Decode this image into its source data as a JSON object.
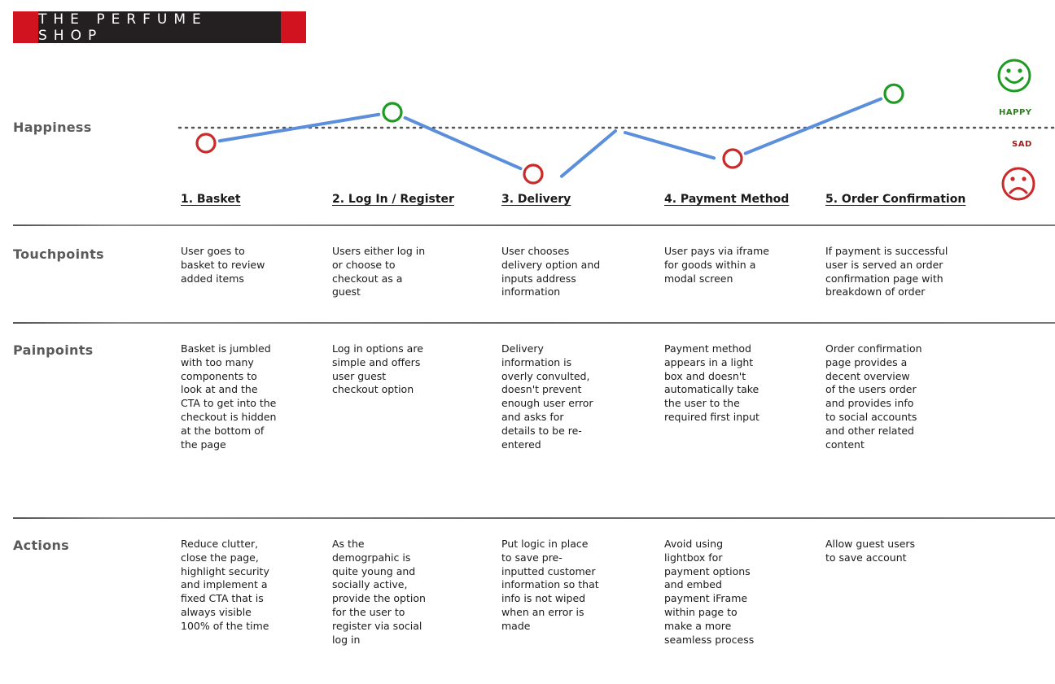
{
  "brand": {
    "name": "THE PERFUME SHOP"
  },
  "legend": {
    "happy_label": "HAPPY",
    "sad_label": "SAD",
    "happy_color": "#1f9a23",
    "sad_color": "#c92a2a"
  },
  "row_labels": {
    "happiness": "Happiness",
    "touchpoints": "Touchpoints",
    "painpoints": "Painpoints",
    "actions": "Actions"
  },
  "chart_data": {
    "type": "line",
    "title": "Happiness",
    "categories": [
      "1. Basket",
      "2. Log In / Register",
      "3. Delivery",
      "4. Payment Method",
      "5. Order Confirmation"
    ],
    "series": [
      {
        "name": "Happiness",
        "values": [
          -1.0,
          1.0,
          -3.0,
          -2.0,
          2.2
        ],
        "color": "#5b8fdb"
      }
    ],
    "point_states": [
      "sad",
      "happy",
      "sad",
      "sad",
      "happy"
    ],
    "baseline": 0,
    "baseline_style": "dotted",
    "ylim": [
      -4,
      4
    ],
    "ylabels": {
      "top": "HAPPY",
      "bottom": "SAD"
    }
  },
  "steps": [
    {
      "title": "1. Basket",
      "touchpoint": "User goes to\nbasket to review\nadded items",
      "painpoint": "Basket is jumbled\nwith too many\ncomponents to\nlook at and the\nCTA to get into the\ncheckout is hidden\nat the bottom of\nthe page",
      "action": "Reduce clutter,\nclose the page,\nhighlight security\nand implement a\nfixed CTA that is\nalways visible\n100% of the time"
    },
    {
      "title": "2. Log In / Register",
      "touchpoint": "Users either log in\nor choose to\ncheckout as a\nguest",
      "painpoint": "Log in options are\nsimple and offers\nuser guest\ncheckout option",
      "action": "As the\ndemogrpahic is\nquite young and\nsocially active,\nprovide the option\nfor the user to\nregister via social\nlog in"
    },
    {
      "title": "3. Delivery",
      "touchpoint": "User chooses\ndelivery option and\ninputs address\ninformation",
      "painpoint": "Delivery\ninformation is\noverly convulted,\ndoesn't prevent\nenough user error\nand asks for\ndetails to be re-\nentered",
      "action": "Put logic in place\nto save pre-\ninputted customer\ninformation so that\ninfo is not wiped\nwhen an error is\nmade"
    },
    {
      "title": "4. Payment Method",
      "touchpoint": "User pays via iframe\nfor goods within a\nmodal screen",
      "painpoint": "Payment method\nappears in a light\nbox and doesn't\nautomatically take\nthe user to the\nrequired first input",
      "action": "Avoid using\nlightbox for\npayment options\nand embed\npayment iFrame\nwithin page to\nmake a more\nseamless process"
    },
    {
      "title": "5. Order Confirmation",
      "touchpoint": "If payment is successful\nuser is served an order\nconfirmation page with\nbreakdown of order",
      "painpoint": "Order confirmation\npage provides a\ndecent overview\nof the users order\nand provides info\nto social accounts\nand other related\ncontent",
      "action": "Allow guest users\nto save account"
    }
  ]
}
